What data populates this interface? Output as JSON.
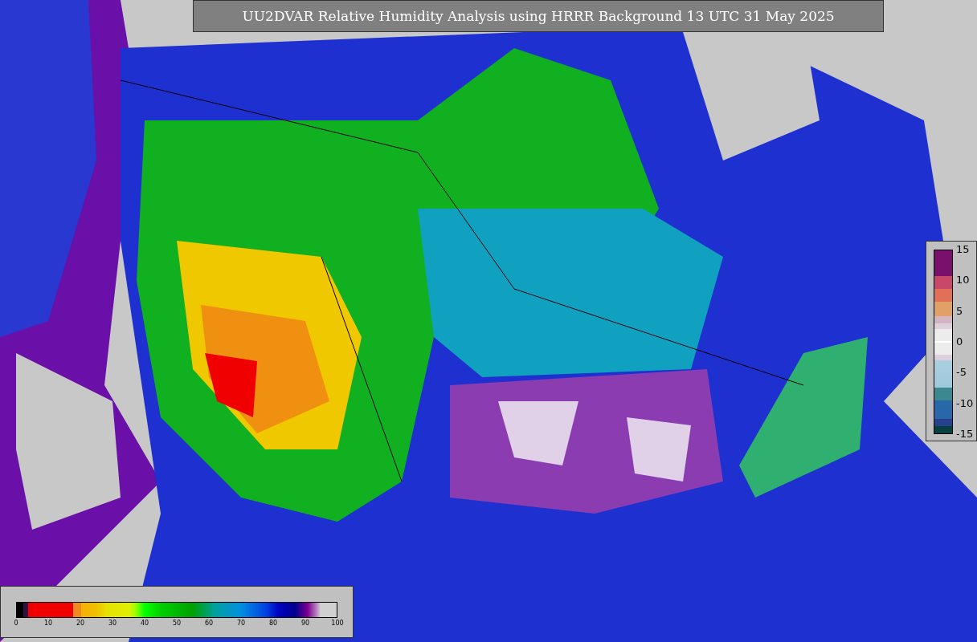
{
  "title": "UU2DVAR Relative Humidity Analysis using HRRR Background 13 UTC 31 May 2025",
  "humidity_colorbar": {
    "ticks": [
      "0",
      "10",
      "20",
      "30",
      "40",
      "50",
      "60",
      "70",
      "80",
      "90",
      "100"
    ]
  },
  "difference_colorbar": {
    "ticks": [
      "15",
      "10",
      "5",
      "0",
      "-5",
      "-10",
      "-15"
    ]
  }
}
